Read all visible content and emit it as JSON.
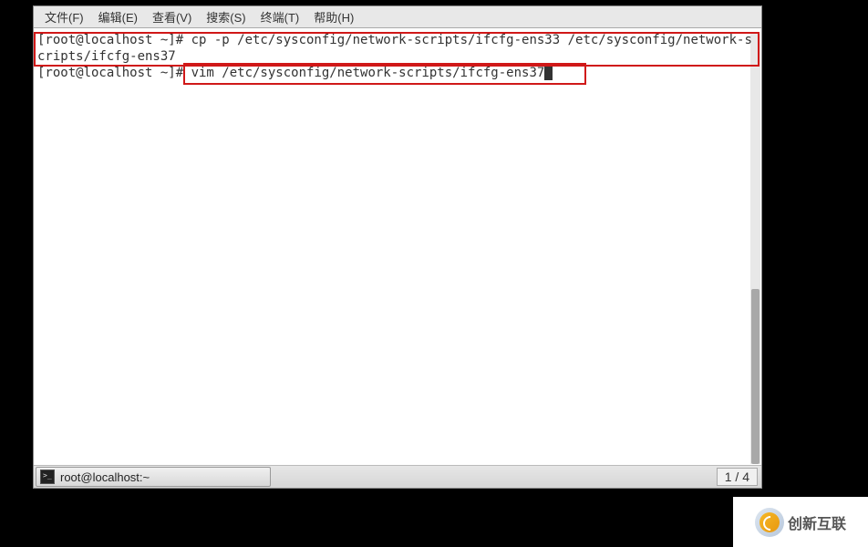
{
  "menu": {
    "file": "文件(F)",
    "edit": "编辑(E)",
    "view": "查看(V)",
    "search": "搜索(S)",
    "terminal": "终端(T)",
    "help": "帮助(H)"
  },
  "terminal": {
    "line1": "[root@localhost ~]# cp -p /etc/sysconfig/network-scripts/ifcfg-ens33 /etc/sysconfig/network-scripts/ifcfg-ens37",
    "line2_prefix": "[root@localhost ~]# ",
    "line2_cmd": "vim /etc/sysconfig/network-scripts/ifcfg-ens37"
  },
  "taskbar": {
    "title": "root@localhost:~"
  },
  "pager": {
    "text": "1 / 4"
  },
  "logo": {
    "text": "创新互联"
  }
}
